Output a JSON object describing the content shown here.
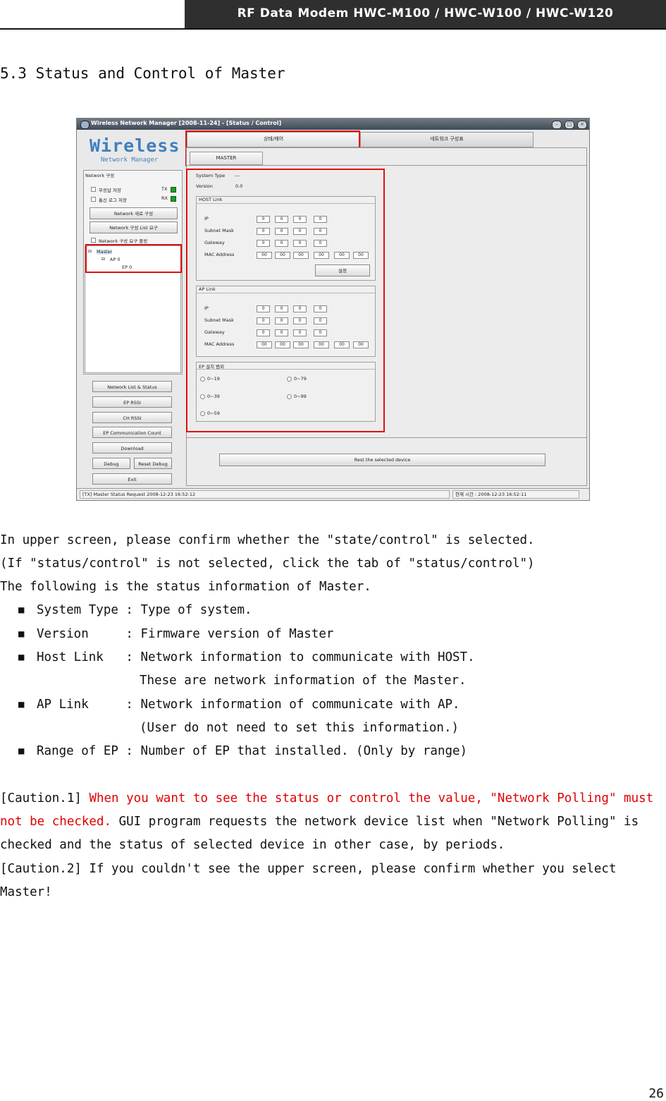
{
  "header": {
    "title": "RF Data Modem HWC-M100 / HWC-W100 / HWC-W120"
  },
  "section": {
    "title": "5.3 Status and Control of Master"
  },
  "app": {
    "window_title": "Wireless Network Manager [2008-11-24] - [Status / Control]",
    "logo": "Wireless",
    "logo_sub": "Network Manager",
    "tabs": {
      "status_control": "상태/제어",
      "network_config": "네트워크 구성표",
      "master": "MASTER"
    },
    "left": {
      "group_title": "Network 구성",
      "chk_response_save": "무응답 저장",
      "chk_log_save": "통신 로그 저장",
      "tx": "TX",
      "rx": "RX",
      "btn_new_network": "Network 새로 구성",
      "btn_list_request": "Network 구성 List 요구",
      "chk_polling": "Network 구성 요구 폴링",
      "tree_master": "Master",
      "tree_ap": "AP 0",
      "tree_ep": "EP 0",
      "btn_network_list": "Network List & Status",
      "btn_ep_rssi": "EP RSSI",
      "btn_ch_rssi": "CH RSSI",
      "btn_ep_comm": "EP Communication Count",
      "btn_download": "Download",
      "btn_debug": "Debug",
      "btn_reset_debug": "Reset Debug",
      "btn_exit": "Exit"
    },
    "right": {
      "system_type_label": "System Type",
      "system_type_value": "---",
      "version_label": "Version",
      "version_value": "0.0",
      "host_link": "HOST Link",
      "ap_link": "AP Link",
      "ip": "IP",
      "subnet": "Subnet Mask",
      "gateway": "Gateway",
      "mac": "MAC Address",
      "zero": "0",
      "mac_zero": "00",
      "set_button": "설정",
      "ep_range": "EP 설치 범위",
      "r1": "0~19",
      "r2": "0~39",
      "r3": "0~59",
      "r4": "0~79",
      "r5": "0~99",
      "rest_button": "Rest the selected device"
    },
    "status_left": "[TX] Master  Status Request 2008-12-23 16:52:12",
    "status_right": "현재 시간 : 2008-12-23 16:52:11"
  },
  "body": {
    "p1": "In upper screen, please confirm whether the \"state/control\" is selected.",
    "p2": " (If \"status/control\" is not selected, click the tab of \"status/control\")",
    "p3": "The following is the status information of Master.",
    "b1": "System Type : Type of system.",
    "b2": "Version     : Firmware version of Master",
    "b3": "Host Link   : Network information to communicate with HOST.",
    "b3b": "These are network information of the Master.",
    "b4": "AP Link     : Network information of communicate with AP.",
    "b4b": "(User do not need to set this information.)",
    "b5": "Range of EP : Number of EP that installed. (Only by range)",
    "c1_label": "[Caution.1]",
    "c1_red1": "When you want to see the status or control the value, \"Network Polling\" must",
    "c1_red2": "not be checked.",
    "c1_rest": "GUI program requests the network device list when \"Network Polling\" is",
    "c1_line3": "checked and the status of selected device in other case, by periods.",
    "c2_line1": "[Caution.2] If you couldn't see the upper screen, please confirm whether you select",
    "c2_line2": "Master!"
  },
  "page_number": "26"
}
